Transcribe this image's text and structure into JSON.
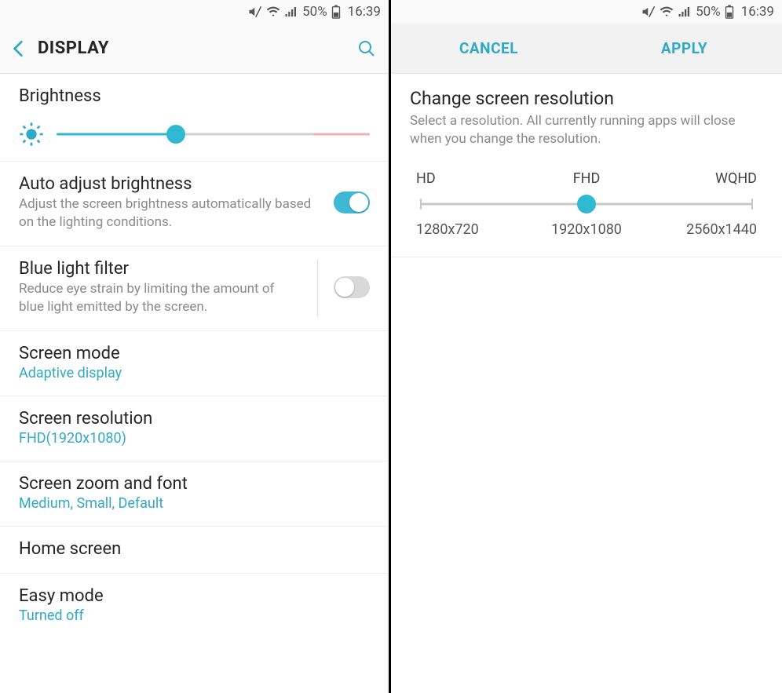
{
  "status": {
    "battery_pct": "50%",
    "time": "16:39"
  },
  "left": {
    "title": "DISPLAY",
    "brightness": {
      "label": "Brightness"
    },
    "auto_adjust": {
      "title": "Auto adjust brightness",
      "desc": "Adjust the screen brightness automatically based on the lighting conditions."
    },
    "blue_light": {
      "title": "Blue light filter",
      "desc": "Reduce eye strain by limiting the amount of blue light emitted by the screen."
    },
    "screen_mode": {
      "title": "Screen mode",
      "value": "Adaptive display"
    },
    "screen_resolution": {
      "title": "Screen resolution",
      "value": "FHD(1920x1080)"
    },
    "screen_zoom": {
      "title": "Screen zoom and font",
      "value": "Medium, Small, Default"
    },
    "home_screen": {
      "title": "Home screen"
    },
    "easy_mode": {
      "title": "Easy mode",
      "value": "Turned off"
    }
  },
  "right": {
    "cancel": "CANCEL",
    "apply": "APPLY",
    "title": "Change screen resolution",
    "desc": "Select a resolution. All currently running apps will close when you change the resolution.",
    "options": {
      "l1": "HD",
      "l2": "FHD",
      "l3": "WQHD",
      "v1": "1280x720",
      "v2": "1920x1080",
      "v3": "2560x1440"
    }
  }
}
